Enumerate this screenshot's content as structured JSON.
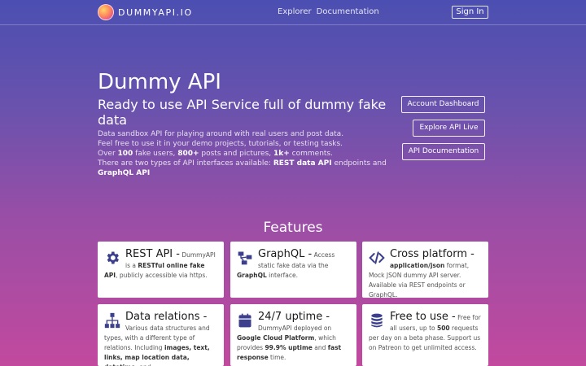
{
  "nav": {
    "logo_text": "DUMMYAPI.IO",
    "links": [
      "Explorer",
      "Documentation"
    ],
    "signin_label": "Sign In"
  },
  "hero": {
    "title": "Dummy API",
    "subtitle": "Ready to use API Service full of dummy fake data",
    "desc": {
      "line1": "Data sandbox API for playing around with real users and post data.",
      "line2": "Feel free to use it in your demo projects, tutorials, or testing tasks.",
      "line3_a": "Over ",
      "line3_b1": "100",
      "line3_c": " fake users, ",
      "line3_b2": "800+",
      "line3_d": " posts and pictures, ",
      "line3_b3": "1k+",
      "line3_e": " comments.",
      "line4_a": "There are two types of API interfaces available: ",
      "line4_b1": "REST data API",
      "line4_c": " endpoints and ",
      "line4_b2": "GraphQL API"
    },
    "buttons": {
      "dashboard": "Account Dashboard",
      "live": "Explore API Live",
      "docs": "API Documentation"
    }
  },
  "features": {
    "title": "Features",
    "cards": [
      {
        "title": "REST API -",
        "t1": " DummyAPI is a ",
        "b1": "RESTful online fake API",
        "t2": ", publicly accessible via https.",
        "icon": "gear-icon"
      },
      {
        "title": "GraphQL -",
        "t1": " Access static fake data via the ",
        "b1": "GraphQL",
        "t2": " interface.",
        "icon": "graph-icon"
      },
      {
        "title": "Cross platform -",
        "t1": " ",
        "b1": "application/json",
        "t2": " format, Mock JSON dummy API server. Available via REST endpoints or GraphQL.",
        "icon": "code-icon"
      },
      {
        "title": "Data relations -",
        "t1": " Various data structures and types, with a different type of relations. Including ",
        "b1": "images, text, links, map location data, datetime,",
        "t2": " and",
        "icon": "sitemap-icon"
      },
      {
        "title": "24/7 uptime -",
        "t1": " DummyAPI deployed on ",
        "b1": "Google Cloud Platform",
        "t2": ", which provides ",
        "b2": "99.9% uptime",
        "t3": " and ",
        "b3": "fast response",
        "t4": " time.",
        "icon": "calendar-icon"
      },
      {
        "title": "Free to use -",
        "t1": " Free for all users, up to ",
        "b1": "500",
        "t2": " requests per day on a beta phase. Support us on Patreon to get unlimited access.",
        "icon": "coins-icon"
      }
    ]
  },
  "colors": {
    "gradient_top": "#4b4fb1",
    "gradient_bottom": "#c2499e",
    "icon_color": "#3b3f8c"
  }
}
